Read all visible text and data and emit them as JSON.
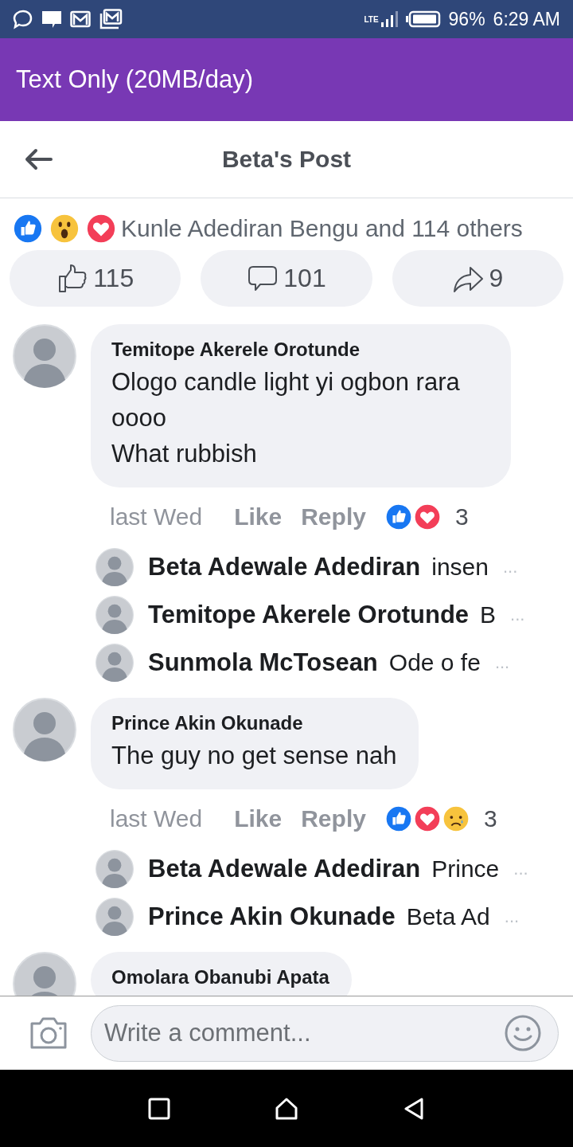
{
  "status_bar": {
    "network": "LTE",
    "battery": "96%",
    "time": "6:29 AM"
  },
  "app_bar": {
    "title": "Text Only (20MB/day)"
  },
  "header": {
    "title": "Beta's Post"
  },
  "reactions_summary": {
    "reactions": [
      {
        "kind": "like"
      },
      {
        "kind": "wow"
      },
      {
        "kind": "love"
      }
    ],
    "text": "Kunle Adediran Bengu and 114 others"
  },
  "stats": [
    {
      "kind": "like",
      "count": "115"
    },
    {
      "kind": "comment",
      "count": "101"
    },
    {
      "kind": "share",
      "count": "9"
    }
  ],
  "comments": [
    {
      "author": "Temitope Akerele Orotunde",
      "lines": [
        "Ologo candle light yi ogbon rara oooo",
        "What rubbish"
      ],
      "time": "last Wed",
      "like": "Like",
      "reply": "Reply",
      "reactions": [
        {
          "kind": "like"
        },
        {
          "kind": "love"
        }
      ],
      "reaction_count": "3",
      "replies": [
        {
          "author": "Beta Adewale Adediran",
          "preview": "insen",
          "more": "..."
        },
        {
          "author": "Temitope Akerele Orotunde",
          "preview": "B",
          "more": "..."
        },
        {
          "author": "Sunmola McTosean",
          "preview": "Ode o fe",
          "more": "..."
        }
      ]
    },
    {
      "author": "Prince Akin Okunade",
      "lines": [
        "The guy no get sense nah"
      ],
      "time": "last Wed",
      "like": "Like",
      "reply": "Reply",
      "reactions": [
        {
          "kind": "like"
        },
        {
          "kind": "love"
        },
        {
          "kind": "sad"
        }
      ],
      "reaction_count": "3",
      "replies": [
        {
          "author": "Beta Adewale Adediran",
          "preview": "Prince",
          "more": "..."
        },
        {
          "author": "Prince Akin Okunade",
          "preview": "Beta Ad",
          "more": "..."
        }
      ]
    },
    {
      "author": "Omolara Obanubi Apata"
    }
  ],
  "composer": {
    "placeholder": "Write a comment..."
  }
}
